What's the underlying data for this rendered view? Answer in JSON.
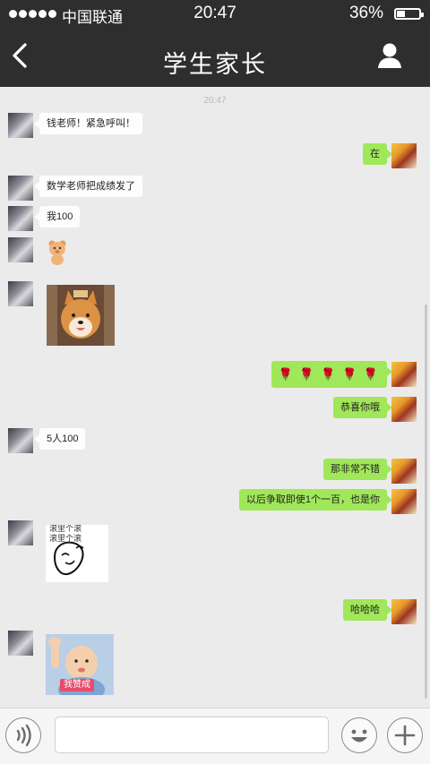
{
  "status_bar": {
    "carrier": "中国联通",
    "time": "20:47",
    "battery_percent": "36%",
    "battery_level": 0.36,
    "signal_bars": 5
  },
  "nav": {
    "title": "学生家长",
    "back_icon": "chevron-left-icon",
    "profile_icon": "person-icon"
  },
  "chat": {
    "timestamp": "20:47",
    "messages": {
      "m1": {
        "side": "in",
        "text": "钱老师！紧急呼叫！"
      },
      "m2": {
        "side": "out",
        "text": "在"
      },
      "m3": {
        "side": "in",
        "text": "数学老师把成绩发了"
      },
      "m4": {
        "side": "in",
        "text": "我100"
      },
      "m5": {
        "side": "in",
        "type": "sticker",
        "sticker": "bear-sticker"
      },
      "m6": {
        "side": "in",
        "type": "sticker",
        "sticker": "shiba-dog-sticker"
      },
      "m7": {
        "side": "out",
        "text": "🌹 🌹 🌹 🌹 🌹"
      },
      "m8": {
        "side": "out",
        "text": "恭喜你哦"
      },
      "m9": {
        "side": "in",
        "text": "5人100"
      },
      "m10": {
        "side": "out",
        "text": "那非常不错"
      },
      "m11": {
        "side": "out",
        "text": "以后争取即使1个一百，也是你"
      },
      "m12": {
        "side": "in",
        "type": "sticker",
        "sticker": "meme-sticker",
        "caption_line1": "滚里个滚",
        "caption_line2": "滚里个滚"
      },
      "m13": {
        "side": "out",
        "text": "哈哈哈"
      },
      "m14": {
        "side": "in",
        "type": "sticker",
        "sticker": "baby-sticker",
        "caption": "我赞成"
      }
    }
  },
  "input_bar": {
    "voice_icon": "voice-icon",
    "text_value": "",
    "emoji_icon": "emoji-icon",
    "plus_icon": "plus-icon"
  },
  "colors": {
    "nav_bg": "#2e2e2e",
    "chat_bg": "#ebebeb",
    "outgoing_bubble": "#a0e75a",
    "incoming_bubble": "#fdfdfd"
  }
}
